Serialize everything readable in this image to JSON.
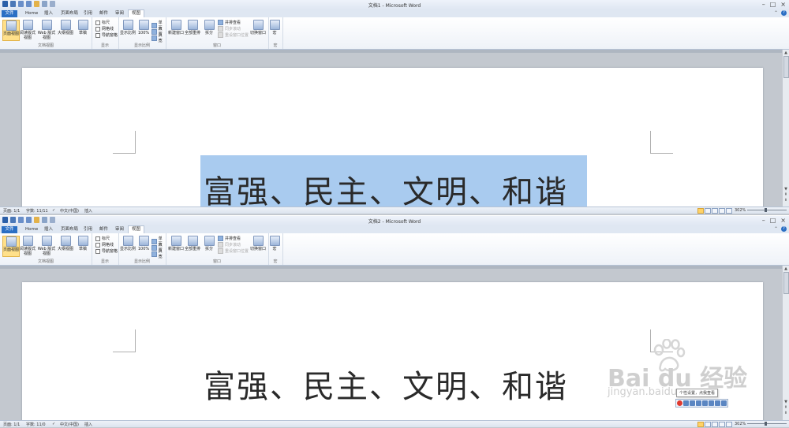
{
  "windows": [
    {
      "title": "文档1 - Microsoft Word",
      "tabs": [
        {
          "label": "文件",
          "kind": "file"
        },
        {
          "label": "Home"
        },
        {
          "label": "插入"
        },
        {
          "label": "页面布局"
        },
        {
          "label": "引用"
        },
        {
          "label": "邮件"
        },
        {
          "label": "审阅"
        },
        {
          "label": "视图",
          "active": true
        }
      ],
      "ribbon": {
        "views": {
          "group": "文档视图",
          "items": [
            "页面视图",
            "阅读版式视图",
            "Web 版式视图",
            "大纲视图",
            "草稿"
          ]
        },
        "show": {
          "group": "显示",
          "items": [
            "标尺",
            "网格线",
            "导航窗格"
          ]
        },
        "zoom": {
          "group": "显示比例",
          "items": [
            "显示比例",
            "100%",
            "单页",
            "双页",
            "页宽"
          ]
        },
        "window": {
          "group": "窗口",
          "items": [
            "新建窗口",
            "全部重排",
            "拆分",
            "并排查看",
            "同步滚动",
            "重设窗口位置",
            "切换窗口"
          ]
        },
        "macro": {
          "group": "宏",
          "items": [
            "宏"
          ]
        }
      },
      "document_text": "富强、民主、文明、和谐",
      "text_selected": true,
      "status": {
        "page": "页面: 1/1",
        "words": "字数: 11/11",
        "language": "中文(中国)",
        "mode": "插入",
        "zoom": "302%"
      }
    },
    {
      "title": "文档2 - Microsoft Word",
      "tabs": [
        {
          "label": "文件",
          "kind": "file"
        },
        {
          "label": "Home"
        },
        {
          "label": "插入"
        },
        {
          "label": "页面布局"
        },
        {
          "label": "引用"
        },
        {
          "label": "邮件"
        },
        {
          "label": "审阅"
        },
        {
          "label": "视图",
          "active": true
        }
      ],
      "ribbon": {
        "views": {
          "group": "文档视图",
          "items": [
            "页面视图",
            "阅读版式视图",
            "Web 版式视图",
            "大纲视图",
            "草稿"
          ]
        },
        "show": {
          "group": "显示",
          "items": [
            "标尺",
            "网格线",
            "导航窗格"
          ]
        },
        "zoom": {
          "group": "显示比例",
          "items": [
            "显示比例",
            "100%",
            "单页",
            "双页",
            "页宽"
          ]
        },
        "window": {
          "group": "窗口",
          "items": [
            "新建窗口",
            "全部重排",
            "拆分",
            "并排查看",
            "同步滚动",
            "重设窗口位置",
            "切换窗口"
          ]
        },
        "macro": {
          "group": "宏",
          "items": [
            "宏"
          ]
        }
      },
      "document_text": "富强、民主、文明、和谐",
      "text_selected": false,
      "status": {
        "page": "页面: 1/1",
        "words": "字数: 11/0",
        "language": "中文(中国)",
        "mode": "插入",
        "zoom": "302%"
      }
    }
  ],
  "ime_tooltip": "个性设置，点我查看",
  "watermark": {
    "brand": "Bai du 经验",
    "url": "jingyan.baidu.com"
  },
  "colors": {
    "accent": "#2b6fc4",
    "selection": "#a9cbef",
    "active_view": "#ffe08a"
  }
}
